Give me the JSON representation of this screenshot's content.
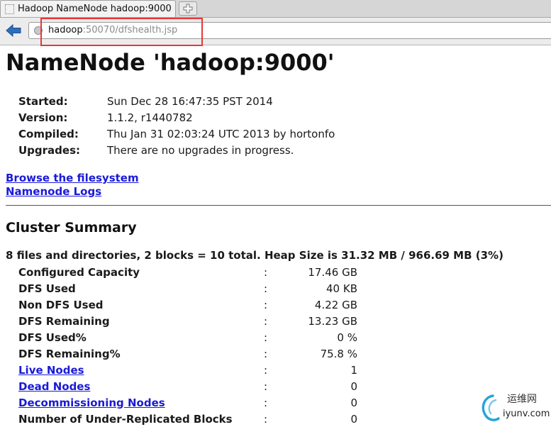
{
  "browser": {
    "tab_title": "Hadoop NameNode hadoop:9000",
    "new_tab_label": "+",
    "url_host": "hadoop",
    "url_rest": ":50070/dfshealth.jsp"
  },
  "page": {
    "title": "NameNode 'hadoop:9000'",
    "info": [
      {
        "key": "Started:",
        "value": "Sun Dec 28 16:47:35 PST 2014"
      },
      {
        "key": "Version:",
        "value": "1.1.2, r1440782"
      },
      {
        "key": "Compiled:",
        "value": "Thu Jan 31 02:03:24 UTC 2013 by hortonfo"
      },
      {
        "key": "Upgrades:",
        "value": "There are no upgrades in progress."
      }
    ],
    "links": [
      "Browse the filesystem",
      "Namenode Logs"
    ],
    "cluster_summary": {
      "heading": "Cluster Summary",
      "summary_line": "8 files and directories, 2 blocks = 10 total. Heap Size is 31.32 MB / 966.69 MB (3%)",
      "rows": [
        {
          "label": "Configured Capacity",
          "colon": ":",
          "value": "17.46 GB"
        },
        {
          "label": "DFS Used",
          "colon": ":",
          "value": "40 KB"
        },
        {
          "label": "Non DFS Used",
          "colon": ":",
          "value": "4.22 GB"
        },
        {
          "label": "DFS Remaining",
          "colon": ":",
          "value": "13.23 GB"
        },
        {
          "label": "DFS Used%",
          "colon": ":",
          "value": "0 %"
        },
        {
          "label": "DFS Remaining%",
          "colon": ":",
          "value": "75.8 %"
        },
        {
          "label": "Live Nodes",
          "colon": ":",
          "value": "1"
        },
        {
          "label": "Dead Nodes",
          "colon": ":",
          "value": "0"
        },
        {
          "label": "Decommissioning Nodes",
          "colon": ":",
          "value": "0"
        },
        {
          "label": "Number of Under-Replicated Blocks",
          "colon": ":",
          "value": "0"
        }
      ]
    }
  },
  "watermark": {
    "cn": "运维网",
    "en": "iyunv.com"
  },
  "colors": {
    "link": "#1a1ad8",
    "highlight_box": "#e8363a",
    "back_arrow": "#2e6fba"
  },
  "icons": {
    "back": "back-arrow-icon",
    "site": "globe-icon",
    "new_tab": "plus-icon"
  }
}
